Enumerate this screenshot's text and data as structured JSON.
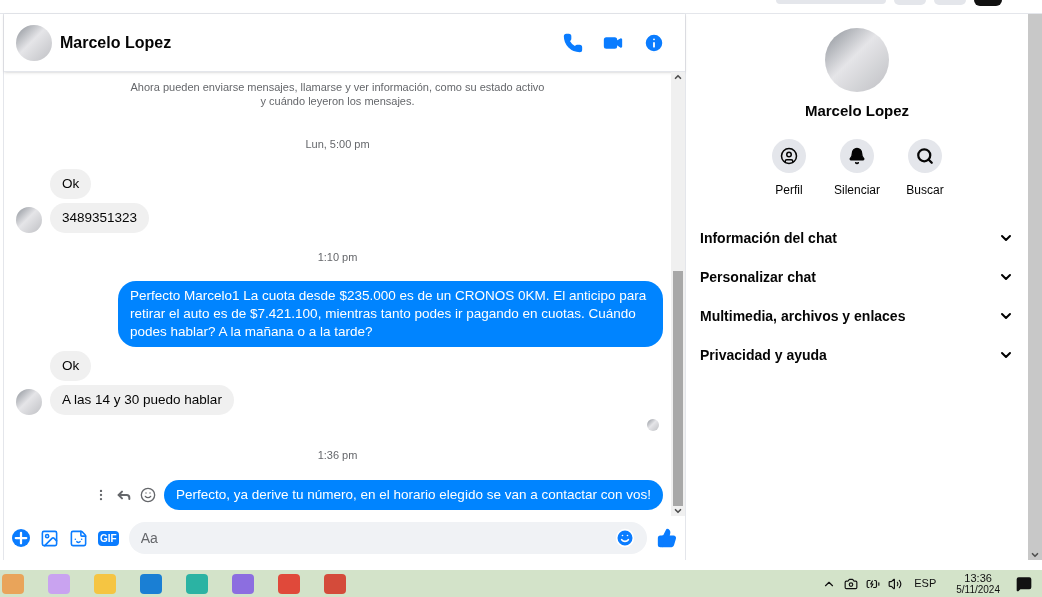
{
  "chat": {
    "contact": "Marcelo Lopez",
    "messages": [
      {
        "kind": "notice",
        "text": "Ahora pueden enviarse mensajes, llamarse y ver información, como su estado activo\ny cuándo leyeron los mensajes."
      },
      {
        "kind": "time",
        "text": "Lun, 5:00 pm"
      },
      {
        "kind": "in",
        "text": "Ok",
        "avatar": false
      },
      {
        "kind": "in",
        "text": "3489351323",
        "avatar": true
      },
      {
        "kind": "time",
        "text": "1:10 pm"
      },
      {
        "kind": "out",
        "text": "Perfecto Marcelo1  La cuota desde $235.000 es de un CRONOS 0KM. El anticipo para retirar el auto es de $7.421.100, mientras tanto podes ir pagando en cuotas. Cuándo podes hablar? A la mañana o a la tarde?",
        "actions": false
      },
      {
        "kind": "in",
        "text": "Ok",
        "avatar": false
      },
      {
        "kind": "in",
        "text": "A las 14 y 30 puedo hablar",
        "avatar": true
      },
      {
        "kind": "seen"
      },
      {
        "kind": "time",
        "text": "1:36 pm"
      },
      {
        "kind": "out",
        "text": "Perfecto, ya derive tu número, en el horario elegido se van a contactar con vos!",
        "actions": true
      }
    ],
    "composer": {
      "gif_label": "GIF",
      "placeholder": "Aa"
    }
  },
  "details": {
    "name": "Marcelo Lopez",
    "actions": [
      {
        "label": "Perfil",
        "kind": "profile"
      },
      {
        "label": "Silenciar",
        "kind": "mute"
      },
      {
        "label": "Buscar",
        "kind": "search"
      }
    ],
    "sections": [
      {
        "label": "Información del chat",
        "expanded": false
      },
      {
        "label": "Personalizar chat",
        "expanded": false
      },
      {
        "label": "Multimedia, archivos y enlaces",
        "expanded": false
      },
      {
        "label": "Privacidad y ayuda",
        "expanded": false
      }
    ]
  },
  "taskbar": {
    "language": "ESP",
    "time": "13:36",
    "date": "5/11/2024"
  }
}
